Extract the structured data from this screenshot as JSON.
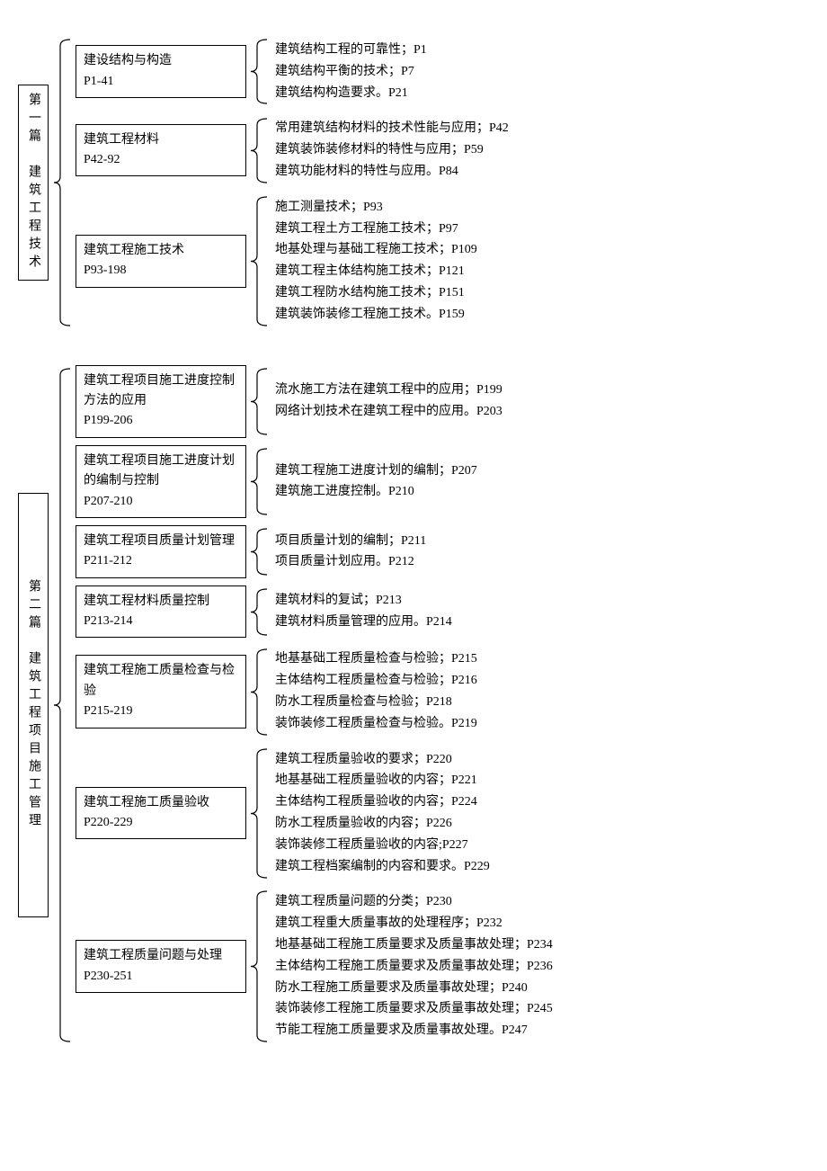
{
  "parts": [
    {
      "title": "第一篇　建筑工程技术",
      "sections": [
        {
          "label": "建设结构与构造\nP1-41",
          "items": [
            "建筑结构工程的可靠性；P1",
            "建筑结构平衡的技术；P7",
            "建筑结构构造要求。P21"
          ]
        },
        {
          "label": "建筑工程材料\nP42-92",
          "items": [
            "常用建筑结构材料的技术性能与应用；P42",
            "建筑装饰装修材料的特性与应用；P59",
            "建筑功能材料的特性与应用。P84"
          ]
        },
        {
          "label": "建筑工程施工技术\nP93-198",
          "items": [
            "施工测量技术；P93",
            "建筑工程土方工程施工技术；P97",
            "地基处理与基础工程施工技术；P109",
            "建筑工程主体结构施工技术；P121",
            "建筑工程防水结构施工技术；P151",
            "建筑装饰装修工程施工技术。P159"
          ]
        }
      ]
    },
    {
      "title": "第二篇　建筑工程项目施工管理",
      "sections": [
        {
          "label": "建筑工程项目施工进度控制方法的应用\nP199-206",
          "items": [
            "流水施工方法在建筑工程中的应用；P199",
            "网络计划技术在建筑工程中的应用。P203"
          ]
        },
        {
          "label": "建筑工程项目施工进度计划的编制与控制\nP207-210",
          "items": [
            "建筑工程施工进度计划的编制；P207",
            "建筑施工进度控制。P210"
          ]
        },
        {
          "label": "建筑工程项目质量计划管理 P211-212",
          "items": [
            "项目质量计划的编制；P211",
            "项目质量计划应用。P212"
          ]
        },
        {
          "label": "建筑工程材料质量控制 P213-214",
          "items": [
            "建筑材料的复试；P213",
            "建筑材料质量管理的应用。P214"
          ]
        },
        {
          "label": "建筑工程施工质量检查与检验\nP215-219",
          "items": [
            "地基基础工程质量检查与检验；P215",
            "主体结构工程质量检查与检验；P216",
            "防水工程质量检查与检验；P218",
            "装饰装修工程质量检查与检验。P219"
          ]
        },
        {
          "label": "建筑工程施工质量验收 P220-229",
          "items": [
            "建筑工程质量验收的要求；P220",
            "地基基础工程质量验收的内容；P221",
            "主体结构工程质量验收的内容；P224",
            "防水工程质量验收的内容；P226",
            "装饰装修工程质量验收的内容;P227",
            "建筑工程档案编制的内容和要求。P229"
          ]
        },
        {
          "label": "建筑工程质量问题与处理 P230-251",
          "items": [
            "建筑工程质量问题的分类；P230",
            "建筑工程重大质量事故的处理程序；P232",
            "地基基础工程施工质量要求及质量事故处理；P234",
            "主体结构工程施工质量要求及质量事故处理；P236",
            "防水工程施工质量要求及质量事故处理；P240",
            "装饰装修工程施工质量要求及质量事故处理；P245",
            "节能工程施工质量要求及质量事故处理。P247"
          ]
        }
      ]
    }
  ]
}
